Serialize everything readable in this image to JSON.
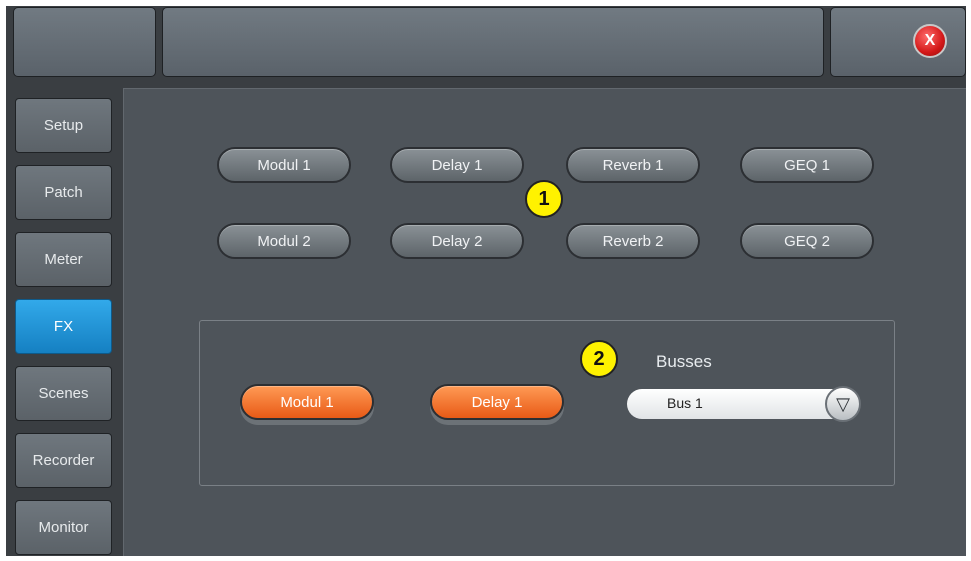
{
  "topbar": {
    "close_label": "X"
  },
  "sidebar": {
    "items": [
      {
        "label": "Setup"
      },
      {
        "label": "Patch"
      },
      {
        "label": "Meter"
      },
      {
        "label": "FX",
        "active": true
      },
      {
        "label": "Scenes"
      },
      {
        "label": "Recorder"
      },
      {
        "label": "Monitor"
      }
    ]
  },
  "fx": {
    "row1": [
      "Modul 1",
      "Delay 1",
      "Reverb 1",
      "GEQ 1"
    ],
    "row2": [
      "Modul 2",
      "Delay 2",
      "Reverb 2",
      "GEQ 2"
    ],
    "annotation_1": "1"
  },
  "busses": {
    "annotation_2": "2",
    "assigned": [
      "Modul 1",
      "Delay 1"
    ],
    "label": "Busses",
    "selected": "Bus 1"
  },
  "colors": {
    "active_tab": "#1e90d6",
    "fx_assigned": "#f26b2a",
    "close": "#d31818",
    "annotation": "#fff200"
  }
}
